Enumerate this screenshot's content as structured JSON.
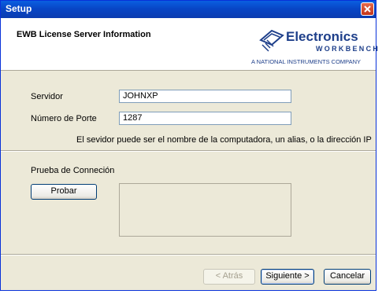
{
  "window": {
    "title": "Setup"
  },
  "header": {
    "title": "EWB License Server Information",
    "logo": {
      "name": "Electronics",
      "sub": "WORKBENCH",
      "tagline": "A NATIONAL INSTRUMENTS COMPANY"
    }
  },
  "form": {
    "server_label": "Servidor",
    "server_value": "JOHNXP",
    "port_label": "Número de Porte",
    "port_value": "1287",
    "hint": "El sevidor puede ser el nombre de la computadora, un alias, o la dirección IP"
  },
  "test": {
    "section_label": "Prueba de Conneción",
    "test_button": "Probar",
    "result_text": ""
  },
  "footer": {
    "back_button": "< Atrás",
    "next_button": "Siguiente >",
    "cancel_button": "Cancelar"
  },
  "colors": {
    "titlebar": "#0846c6",
    "dialog_bg": "#ece9d8",
    "logo_blue": "#1e3f8a"
  }
}
